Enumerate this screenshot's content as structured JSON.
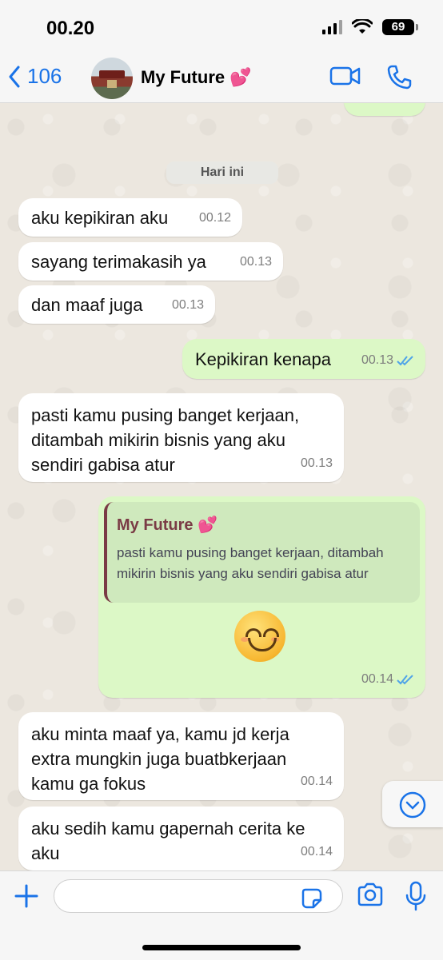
{
  "status_bar": {
    "time": "00.20",
    "battery": "69"
  },
  "header": {
    "back_count": "106",
    "contact_name": "My Future 💕"
  },
  "date_separator": "Hari ini",
  "messages": [
    {
      "text": "aku kepikiran aku",
      "time": "00.12"
    },
    {
      "text": "sayang terimakasih ya",
      "time": "00.13"
    },
    {
      "text": "dan maaf juga",
      "time": "00.13"
    },
    {
      "text": "Kepikiran kenapa",
      "time": "00.13"
    },
    {
      "text": "pasti kamu pusing banget kerjaan, ditambah mikirin bisnis yang aku sendiri gabisa atur",
      "time": "00.13"
    },
    {
      "quote_name": "My Future 💕",
      "quote_text": "pasti kamu pusing banget kerjaan, ditambah mikirin bisnis yang aku sendiri gabisa atur",
      "time": "00.14"
    },
    {
      "text": "aku minta maaf ya, kamu jd kerja extra mungkin juga buatbkerjaan kamu ga fokus",
      "time": "00.14"
    },
    {
      "text": "aku sedih kamu gapernah cerita ke aku",
      "time": "00.14"
    }
  ],
  "icons": {
    "back": "chevron-left-icon",
    "video": "video-call-icon",
    "phone": "phone-icon",
    "scroll": "chevron-down-icon",
    "attach": "plus-icon",
    "sticker": "sticker-icon",
    "camera": "camera-icon",
    "mic": "microphone-icon"
  },
  "colors": {
    "accent": "#1a73e8",
    "incoming": "#ffffff",
    "outgoing": "#dcf8c6",
    "quote_bar": "#7a3b45"
  }
}
